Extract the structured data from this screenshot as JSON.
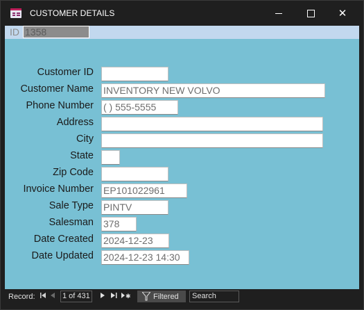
{
  "window": {
    "title": "CUSTOMER DETAILS",
    "minimize_glyph": "",
    "close_glyph": "✕"
  },
  "record_selector": {
    "label": "ID",
    "value": "1358"
  },
  "form": {
    "fields": [
      {
        "label": "Customer ID",
        "value": ""
      },
      {
        "label": "Customer Name",
        "value": "INVENTORY NEW VOLVO"
      },
      {
        "label": "Phone Number",
        "value": "(    ) 555-5555"
      },
      {
        "label": "Address",
        "value": ""
      },
      {
        "label": "City",
        "value": ""
      },
      {
        "label": "State",
        "value": ""
      },
      {
        "label": "Zip Code",
        "value": ""
      },
      {
        "label": "Invoice Number",
        "value": "EP101022961"
      },
      {
        "label": "Sale Type",
        "value": "PINTV"
      },
      {
        "label": "Salesman",
        "value": "378"
      },
      {
        "label": "Date Created",
        "value": "2024-12-23"
      },
      {
        "label": "Date Updated",
        "value": "2024-12-23 14:30"
      }
    ]
  },
  "navigation": {
    "record_label": "Record:",
    "first_icon": "first-record-icon",
    "prev_icon": "previous-record-icon",
    "counter": "1 of 431",
    "next_icon": "next-record-icon",
    "last_icon": "last-record-icon",
    "new_icon": "new-record-icon",
    "filter_label": "Filtered",
    "search_placeholder": "Search"
  },
  "colors": {
    "detail_background": "#78c0d4",
    "id_strip": "#c2d8ee",
    "titlebar": "#1f1f1f"
  }
}
